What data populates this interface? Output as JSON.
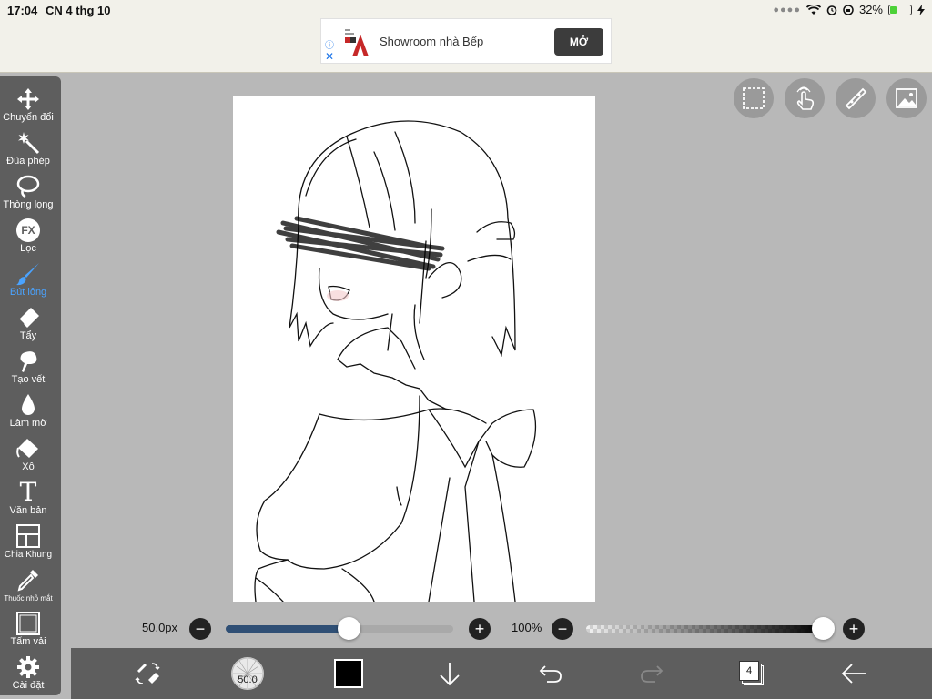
{
  "status": {
    "time": "17:04",
    "date": "CN 4 thg 10",
    "battery": "32%",
    "battery_level": 0.32
  },
  "ad": {
    "text": "Showroom nhà Bếp",
    "button": "MỞ"
  },
  "tools": [
    {
      "label": "Chuyển đổi",
      "icon": "move-icon"
    },
    {
      "label": "Đũa phép",
      "icon": "magic-wand-icon"
    },
    {
      "label": "Thòng lọng",
      "icon": "lasso-icon"
    },
    {
      "label": "Lọc",
      "icon": "fx-filter-icon",
      "icon_text": "FX"
    },
    {
      "label": "Bút lông",
      "icon": "brush-icon",
      "active": true
    },
    {
      "label": "Tẩy",
      "icon": "eraser-icon"
    },
    {
      "label": "Tạo vết",
      "icon": "smudge-icon"
    },
    {
      "label": "Làm mờ",
      "icon": "blur-drop-icon"
    },
    {
      "label": "Xô",
      "icon": "bucket-icon"
    },
    {
      "label": "Văn bản",
      "icon": "text-icon",
      "icon_text": "T"
    },
    {
      "label": "Chia Khung",
      "icon": "frame-divide-icon"
    },
    {
      "label": "Thuốc nhỏ mắt",
      "icon": "eyedropper-icon"
    },
    {
      "label": "Tấm vải",
      "icon": "canvas-icon"
    },
    {
      "label": "Cài đặt",
      "icon": "gear-icon"
    }
  ],
  "brush": {
    "size_label": "50.0px",
    "size_value": 50.0,
    "size_fraction": 0.54,
    "preview_label": "50.0"
  },
  "opacity": {
    "label": "100%",
    "fraction": 1.0
  },
  "layers": {
    "count": "4"
  },
  "colors": {
    "toolbar": "#5e5e5e",
    "active": "#4aa3ff",
    "slider_fill": "#2f4f75",
    "current_color": "#000000"
  }
}
